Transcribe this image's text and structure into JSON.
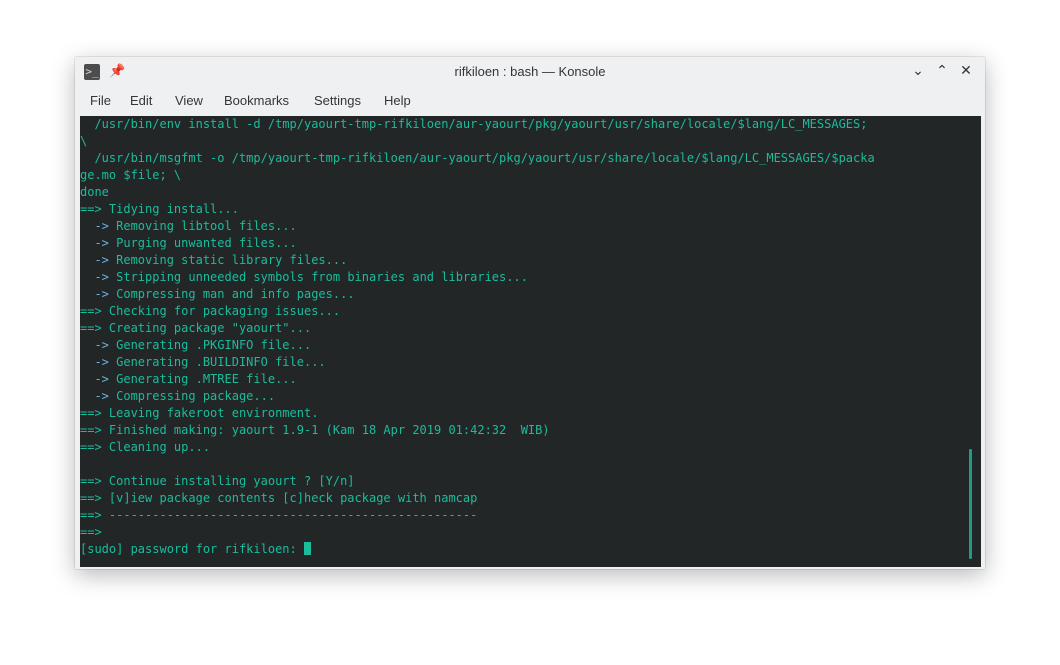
{
  "window": {
    "title": "rifkiloen : bash — Konsole",
    "app_icon": "terminal-icon",
    "pin_icon": "pin-icon",
    "controls": {
      "minimize": "⌄",
      "maximize": "⌃",
      "close": "✕"
    }
  },
  "menu": {
    "items": [
      "File",
      "Edit",
      "View",
      "Bookmarks",
      "Settings",
      "Help"
    ]
  },
  "terminal": {
    "lines": [
      {
        "text": "  /usr/bin/env install -d /tmp/yaourt-tmp-rifkiloen/aur-yaourt/pkg/yaourt/usr/share/locale/$lang/LC_MESSAGES;",
        "kind": "plain"
      },
      {
        "text": "\\",
        "kind": "plain"
      },
      {
        "text": "  /usr/bin/msgfmt -o /tmp/yaourt-tmp-rifkiloen/aur-yaourt/pkg/yaourt/usr/share/locale/$lang/LC_MESSAGES/$packa",
        "kind": "plain"
      },
      {
        "text": "ge.mo $file; \\",
        "kind": "plain"
      },
      {
        "text": "done",
        "kind": "plain"
      },
      {
        "text": "==> Tidying install...",
        "kind": "plain"
      },
      {
        "text": "  -> Removing libtool files...",
        "kind": "sub"
      },
      {
        "text": "  -> Purging unwanted files...",
        "kind": "sub"
      },
      {
        "text": "  -> Removing static library files...",
        "kind": "sub"
      },
      {
        "text": "  -> Stripping unneeded symbols from binaries and libraries...",
        "kind": "sub"
      },
      {
        "text": "  -> Compressing man and info pages...",
        "kind": "sub"
      },
      {
        "text": "==> Checking for packaging issues...",
        "kind": "plain"
      },
      {
        "text": "==> Creating package \"yaourt\"...",
        "kind": "plain"
      },
      {
        "text": "  -> Generating .PKGINFO file...",
        "kind": "sub"
      },
      {
        "text": "  -> Generating .BUILDINFO file...",
        "kind": "sub"
      },
      {
        "text": "  -> Generating .MTREE file...",
        "kind": "sub"
      },
      {
        "text": "  -> Compressing package...",
        "kind": "sub"
      },
      {
        "text": "==> Leaving fakeroot environment.",
        "kind": "plain"
      },
      {
        "text": "==> Finished making: yaourt 1.9-1 (Kam 18 Apr 2019 01:42:32  WIB)",
        "kind": "plain"
      },
      {
        "text": "==> Cleaning up...",
        "kind": "plain"
      },
      {
        "text": "",
        "kind": "plain"
      },
      {
        "text": "==> Continue installing yaourt ? [Y/n]",
        "kind": "plain"
      },
      {
        "text": "==> [v]iew package contents [c]heck package with namcap",
        "kind": "plain"
      },
      {
        "text": "==> ---------------------------------------------------",
        "kind": "plain"
      },
      {
        "text": "==>",
        "kind": "plain"
      },
      {
        "text": "[sudo] password for rifkiloen: ",
        "kind": "prompt"
      }
    ],
    "colors": {
      "background": "#232627",
      "text": "#1abc9c",
      "arrow": "#6ab5e0"
    }
  }
}
